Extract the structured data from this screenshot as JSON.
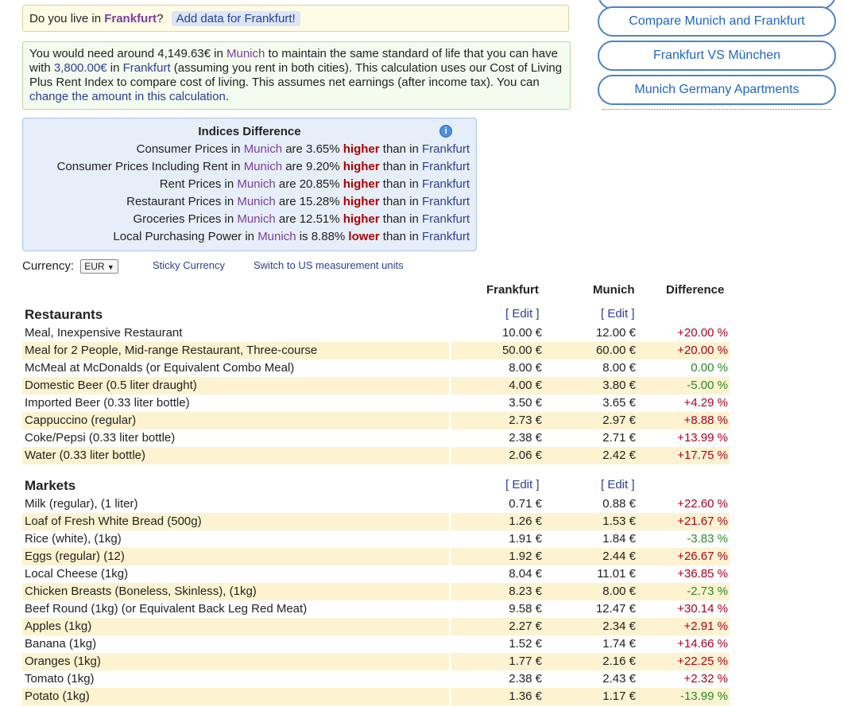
{
  "live": {
    "prefix": "Do you live in ",
    "city": "Frankfurt",
    "suffix": "?",
    "add_data": "Add data for Frankfurt!"
  },
  "summary": {
    "t1": "You would need around 4,149.63€ in ",
    "city_b": "Munich",
    "t2": " to maintain the same standard of life that you can have with ",
    "amount": "3,800.00€",
    "t3": " in ",
    "city_a": "Frankfurt",
    "t4": " (assuming you rent in both cities). This calculation uses our Cost of Living Plus Rent Index to compare cost of living. This assumes net earnings (after income tax). You can ",
    "change_link": "change the amount in this calculation",
    "t5": "."
  },
  "side_buttons": [
    "Compare Munich and Frankfurt",
    "Frankfurt VS München",
    "Munich Germany Apartments"
  ],
  "indices": {
    "title": "Indices Difference",
    "rows": [
      {
        "pre": "Consumer Prices in ",
        "city_b": "Munich",
        "mid": " are 3.65% ",
        "dir": "higher",
        "post": " than in ",
        "city_a": "Frankfurt"
      },
      {
        "pre": "Consumer Prices Including Rent in ",
        "city_b": "Munich",
        "mid": " are 9.20% ",
        "dir": "higher",
        "post": " than in ",
        "city_a": "Frankfurt"
      },
      {
        "pre": "Rent Prices in ",
        "city_b": "Munich",
        "mid": " are 20.85% ",
        "dir": "higher",
        "post": " than in ",
        "city_a": "Frankfurt"
      },
      {
        "pre": "Restaurant Prices in ",
        "city_b": "Munich",
        "mid": " are 15.28% ",
        "dir": "higher",
        "post": " than in ",
        "city_a": "Frankfurt"
      },
      {
        "pre": "Groceries Prices in ",
        "city_b": "Munich",
        "mid": " are 12.51% ",
        "dir": "higher",
        "post": " than in ",
        "city_a": "Frankfurt"
      },
      {
        "pre": "Local Purchasing Power in ",
        "city_b": "Munich",
        "mid": " is 8.88% ",
        "dir": "lower",
        "post": " than in ",
        "city_a": "Frankfurt"
      }
    ]
  },
  "currency": {
    "label": "Currency:",
    "selected": "EUR",
    "sticky": "Sticky Currency",
    "units": "Switch to US measurement units"
  },
  "columns": {
    "c1": "Frankfurt",
    "c2": "Munich",
    "c3": "Difference",
    "edit": "[ Edit ]"
  },
  "sections": [
    {
      "title": "Restaurants",
      "rows": [
        {
          "name": "Meal, Inexpensive Restaurant",
          "a": "10.00 €",
          "b": "12.00 €",
          "d": "+20.00 %"
        },
        {
          "name": "Meal for 2 People, Mid-range Restaurant, Three-course",
          "a": "50.00 €",
          "b": "60.00 €",
          "d": "+20.00 %"
        },
        {
          "name": "McMeal at McDonalds (or Equivalent Combo Meal)",
          "a": "8.00 €",
          "b": "8.00 €",
          "d": "0.00 %"
        },
        {
          "name": "Domestic Beer (0.5 liter draught)",
          "a": "4.00 €",
          "b": "3.80 €",
          "d": "-5.00 %"
        },
        {
          "name": "Imported Beer (0.33 liter bottle)",
          "a": "3.50 €",
          "b": "3.65 €",
          "d": "+4.29 %"
        },
        {
          "name": "Cappuccino (regular)",
          "a": "2.73 €",
          "b": "2.97 €",
          "d": "+8.88 %"
        },
        {
          "name": "Coke/Pepsi (0.33 liter bottle)",
          "a": "2.38 €",
          "b": "2.71 €",
          "d": "+13.99 %"
        },
        {
          "name": "Water (0.33 liter bottle)",
          "a": "2.06 €",
          "b": "2.42 €",
          "d": "+17.75 %"
        }
      ]
    },
    {
      "title": "Markets",
      "rows": [
        {
          "name": "Milk (regular), (1 liter)",
          "a": "0.71 €",
          "b": "0.88 €",
          "d": "+22.60 %"
        },
        {
          "name": "Loaf of Fresh White Bread (500g)",
          "a": "1.26 €",
          "b": "1.53 €",
          "d": "+21.67 %"
        },
        {
          "name": "Rice (white), (1kg)",
          "a": "1.91 €",
          "b": "1.84 €",
          "d": "-3.83 %"
        },
        {
          "name": "Eggs (regular) (12)",
          "a": "1.92 €",
          "b": "2.44 €",
          "d": "+26.67 %"
        },
        {
          "name": "Local Cheese (1kg)",
          "a": "8.04 €",
          "b": "11.01 €",
          "d": "+36.85 %"
        },
        {
          "name": "Chicken Breasts (Boneless, Skinless), (1kg)",
          "a": "8.23 €",
          "b": "8.00 €",
          "d": "-2.73 %"
        },
        {
          "name": "Beef Round (1kg) (or Equivalent Back Leg Red Meat)",
          "a": "9.58 €",
          "b": "12.47 €",
          "d": "+30.14 %"
        },
        {
          "name": "Apples (1kg)",
          "a": "2.27 €",
          "b": "2.34 €",
          "d": "+2.91 %"
        },
        {
          "name": "Banana (1kg)",
          "a": "1.52 €",
          "b": "1.74 €",
          "d": "+14.66 %"
        },
        {
          "name": "Oranges (1kg)",
          "a": "1.77 €",
          "b": "2.16 €",
          "d": "+22.25 %"
        },
        {
          "name": "Tomato (1kg)",
          "a": "2.38 €",
          "b": "2.43 €",
          "d": "+2.32 %"
        },
        {
          "name": "Potato (1kg)",
          "a": "1.36 €",
          "b": "1.17 €",
          "d": "-13.99 %"
        }
      ]
    }
  ]
}
